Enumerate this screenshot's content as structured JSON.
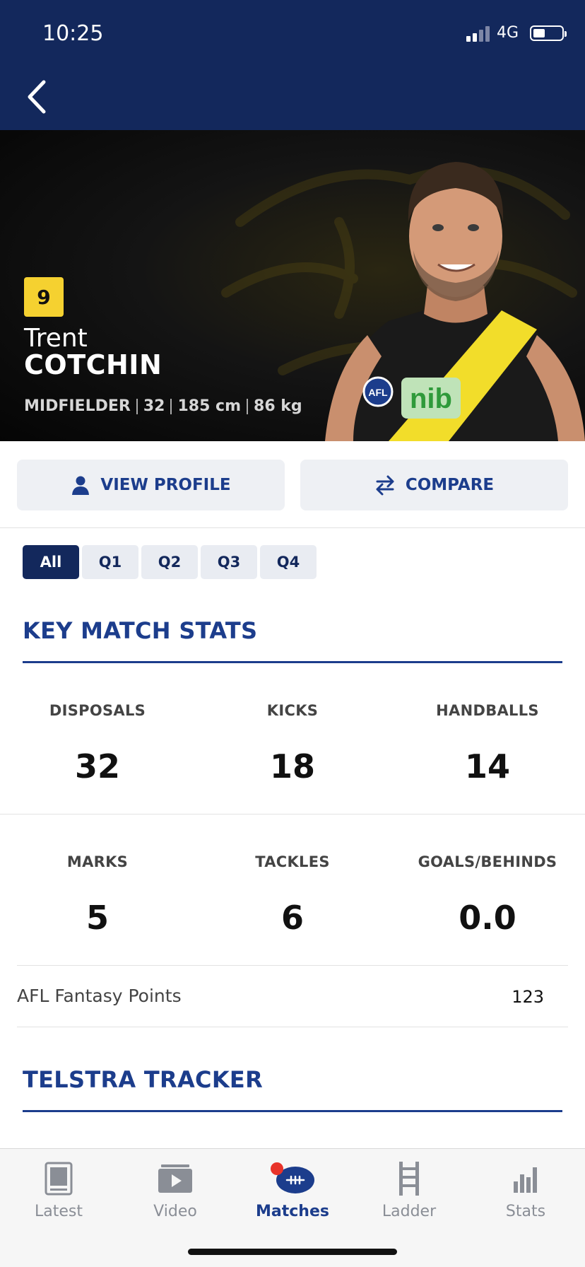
{
  "status_bar": {
    "time": "10:25",
    "network": "4G"
  },
  "player": {
    "number": "9",
    "first_name": "Trent",
    "last_name": "COTCHIN",
    "position": "MIDFIELDER",
    "age": "32",
    "height": "185 cm",
    "weight": "86 kg"
  },
  "actions": {
    "view_profile": "VIEW PROFILE",
    "compare": "COMPARE"
  },
  "quarter_tabs": [
    "All",
    "Q1",
    "Q2",
    "Q3",
    "Q4"
  ],
  "selected_tab": "All",
  "key_stats": {
    "title": "KEY MATCH STATS",
    "items": [
      {
        "label": "DISPOSALS",
        "value": "32"
      },
      {
        "label": "KICKS",
        "value": "18"
      },
      {
        "label": "HANDBALLS",
        "value": "14"
      },
      {
        "label": "MARKS",
        "value": "5"
      },
      {
        "label": "TACKLES",
        "value": "6"
      },
      {
        "label": "GOALS/BEHINDS",
        "value": "0.0"
      }
    ]
  },
  "fantasy": {
    "label": "AFL Fantasy Points",
    "value": "123"
  },
  "tracker": {
    "title": "TELSTRA TRACKER"
  },
  "bottom_nav": [
    {
      "label": "Latest",
      "icon": "news-icon"
    },
    {
      "label": "Video",
      "icon": "video-icon"
    },
    {
      "label": "Matches",
      "icon": "football-icon",
      "active": true
    },
    {
      "label": "Ladder",
      "icon": "ladder-icon"
    },
    {
      "label": "Stats",
      "icon": "bar-chart-icon"
    }
  ],
  "colors": {
    "header": "#13285c",
    "accent": "#1c3d8c",
    "badge": "#f5d130"
  }
}
